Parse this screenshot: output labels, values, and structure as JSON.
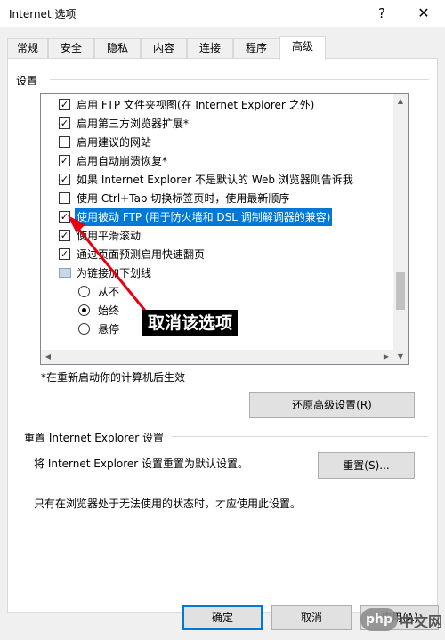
{
  "window": {
    "title": "Internet 选项",
    "help": "?",
    "close": "✕"
  },
  "tabs": [
    {
      "label": "常规"
    },
    {
      "label": "安全"
    },
    {
      "label": "隐私"
    },
    {
      "label": "内容"
    },
    {
      "label": "连接"
    },
    {
      "label": "程序"
    },
    {
      "label": "高级",
      "active": true
    }
  ],
  "settings": {
    "group_label": "设置",
    "items": [
      {
        "type": "checkbox",
        "checked": true,
        "label": "启用 FTP 文件夹视图(在 Internet Explorer 之外)"
      },
      {
        "type": "checkbox",
        "checked": true,
        "label": "启用第三方浏览器扩展*"
      },
      {
        "type": "checkbox",
        "checked": false,
        "label": "启用建议的网站"
      },
      {
        "type": "checkbox",
        "checked": true,
        "label": "启用自动崩溃恢复*"
      },
      {
        "type": "checkbox",
        "checked": true,
        "label": "如果 Internet Explorer 不是默认的 Web 浏览器则告诉我"
      },
      {
        "type": "checkbox",
        "checked": false,
        "label": "使用 Ctrl+Tab 切换标签页时，使用最新顺序"
      },
      {
        "type": "checkbox",
        "checked": true,
        "selected": true,
        "label": "使用被动 FTP (用于防火墙和 DSL 调制解调器的兼容)"
      },
      {
        "type": "checkbox",
        "checked": true,
        "label": "使用平滑滚动"
      },
      {
        "type": "checkbox",
        "checked": true,
        "label": "通过页面预测启用快速翻页"
      },
      {
        "type": "folder",
        "label": "为链接加下划线"
      },
      {
        "type": "radio",
        "checked": false,
        "label": "从不"
      },
      {
        "type": "radio",
        "checked": true,
        "label": "始终"
      },
      {
        "type": "radio",
        "checked": false,
        "label": "悬停"
      }
    ],
    "check_mark": "✓"
  },
  "annotation": {
    "text": "取消该选项"
  },
  "restart_note": "*在重新启动你的计算机后生效",
  "restore_button": "还原高级设置(R)",
  "reset_section": {
    "title": "重置 Internet Explorer 设置",
    "description": "将 Internet Explorer 设置重置为默认设置。",
    "button": "重置(S)...",
    "note": "只有在浏览器处于无法使用的状态时，才应使用此设置。"
  },
  "footer": {
    "ok": "确定",
    "cancel": "取消",
    "apply": "应用(A)"
  },
  "watermark": {
    "badge": "php",
    "text": "中文网"
  },
  "scroll_arrows": {
    "up": "▲",
    "down": "▼",
    "left": "◀",
    "right": "▶"
  }
}
